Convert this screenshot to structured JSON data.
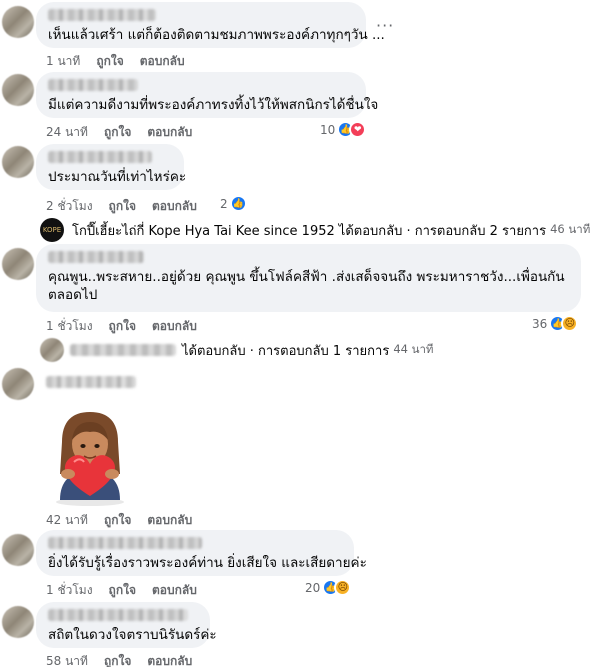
{
  "actions": {
    "like": "ถูกใจ",
    "reply": "ตอบกลับ",
    "more": "···"
  },
  "comments": [
    {
      "text": "เห็นแล้วเศร้า แต่ก็ต้องติดตามชมภาพพระองค์ภาทุกๆวัน ...",
      "time": "1 นาที"
    },
    {
      "text": "มีแต่ความดีงามที่พระองค์ภาทรงทิ้งไว้ให้พสกนิกรได้ชื่นใจ",
      "time": "24 นาที",
      "reactions": "10"
    },
    {
      "text": "ประมาณวันที่เท่าไหร่คะ",
      "time": "2 ชั่วโมง",
      "reactions": "2"
    },
    {
      "text": "คุณพูน..พระสหาย..อยู่ด้วย คุณพูน ขึ้นโฟล์คสีฟ้า .ส่งเสด็จจนถึง พระมหาราชวัง...เพื่อนกันตลอดไป",
      "time": "1 ชั่วโมง",
      "reactions": "36"
    },
    {
      "time": "42 นาที"
    },
    {
      "text": "ยิ่งได้รับรู้เรื่องราวพระองค์ท่าน ยิ่งเสียใจ และเสียดายค่ะ",
      "time": "1 ชั่วโมง",
      "reactions": "20"
    },
    {
      "text": "สถิตในดวงใจตราบนิรันดร์ค่ะ",
      "time": "58 นาที"
    }
  ],
  "page_reply": {
    "page_name": "โกปี๊เฮี้ยะไถ่กี่ Kope Hya Tai Kee since 1952",
    "action_text": "ได้ตอบกลับ · การตอบกลับ 2 รายการ",
    "time": "46 นาที"
  },
  "user_reply": {
    "action_text": "ได้ตอบกลับ · การตอบกลับ 1 รายการ",
    "time": "44 นาที"
  },
  "colors": {
    "like": "#1877f2",
    "love": "#f33e58",
    "sad": "#f7b125",
    "bubble": "#f0f2f5",
    "meta": "#65676b"
  },
  "icons": [
    "like-reaction-icon",
    "love-reaction-icon",
    "sad-reaction-icon",
    "page-avatar-icon",
    "more-options-icon"
  ]
}
